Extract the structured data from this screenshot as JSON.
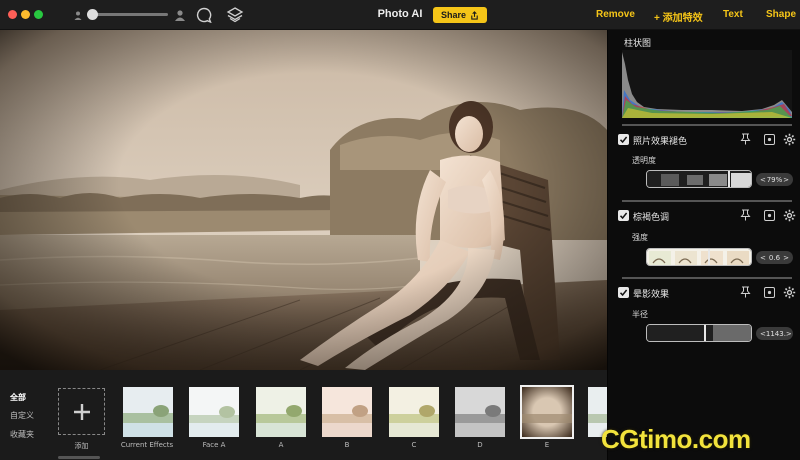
{
  "window": {
    "title": "Photo AI",
    "share_label": "Share"
  },
  "toolbar": {
    "remove_label": "Remove",
    "add_effect_label": "+ 添加特效",
    "text_label": "Text",
    "shape_label": "Shape",
    "zoom_level_fraction": 0.05
  },
  "panel": {
    "histogram_title": "柱状图",
    "sections": [
      {
        "title": "照片效果褪色",
        "param_label": "透明度",
        "value": "79%",
        "value_fraction": 0.79,
        "checked": true
      },
      {
        "title": "棕褐色调",
        "param_label": "强度",
        "value": "0.6",
        "value_fraction": 0.6,
        "checked": true
      },
      {
        "title": "晕影效果",
        "param_label": "半径",
        "value": "1143.",
        "value_fraction": 0.56,
        "checked": true
      }
    ],
    "step_left": "<",
    "step_right": ">"
  },
  "bottom": {
    "categories": [
      "全部",
      "自定义",
      "收藏夹"
    ],
    "add_label": "添加",
    "presets": [
      "Current Effects",
      "Face A",
      "A",
      "B",
      "C",
      "D",
      "E"
    ],
    "selected_preset": "E"
  },
  "watermark": "CGtimo.com",
  "icons": [
    "person-small-icon",
    "person-large-icon",
    "chat-bubble-icon",
    "layers-icon",
    "share-icon",
    "checkbox-check-icon",
    "pin-icon",
    "square-dot-icon",
    "gear-icon",
    "plus-icon"
  ],
  "colors": {
    "accent": "#f5c518",
    "panel_bg": "#0c0c0c",
    "bottom_bg": "#1b1b1b"
  }
}
